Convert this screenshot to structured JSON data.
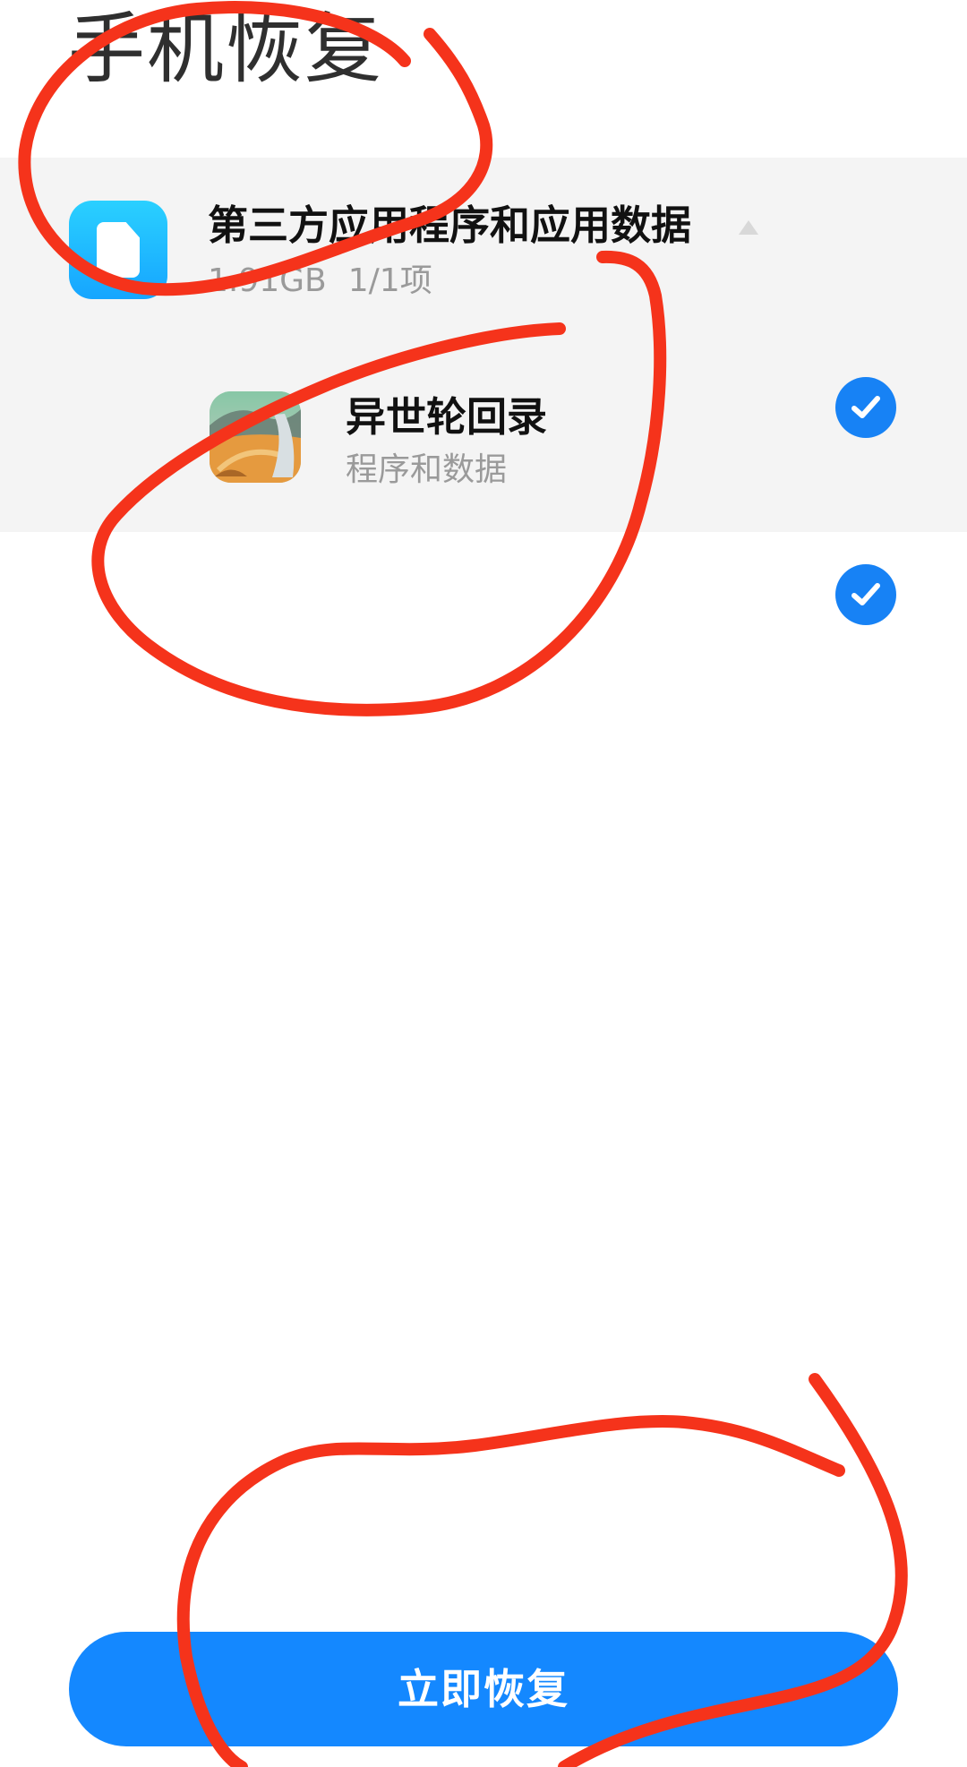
{
  "screen": {
    "title": "手机恢复"
  },
  "restore_list": {
    "group": {
      "icon": "document-icon",
      "title": "第三方应用程序和应用数据",
      "size": "1.91GB",
      "count": "1/1项",
      "expand_icon": "triangle-up-icon",
      "checked": true
    },
    "items": [
      {
        "icon": "game-app-icon",
        "name": "异世轮回录",
        "detail": "程序和数据",
        "checked": true
      }
    ]
  },
  "actions": {
    "restore_now_label": "立即恢复"
  },
  "colors": {
    "accent": "#1488ff",
    "checkmark": "#1782f5",
    "annotation": "#f5331b",
    "list_background": "#f4f4f4",
    "secondary_text": "#9a9a9a"
  }
}
